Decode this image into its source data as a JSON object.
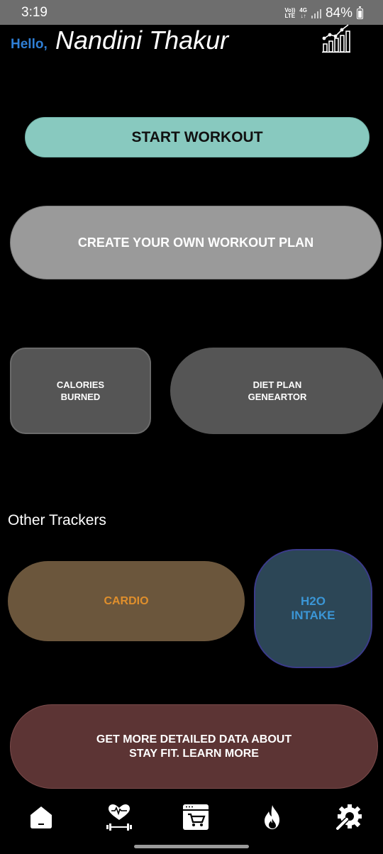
{
  "status_bar": {
    "time": "3:19",
    "volte": "Vo)) LTE",
    "network": "4G",
    "battery": "84%"
  },
  "header": {
    "greeting": "Hello,",
    "user_name": "Nandini Thakur",
    "stats_icon": "bar-chart-trend-icon"
  },
  "actions": {
    "start_workout": "START WORKOUT",
    "create_plan": "CREATE YOUR OWN WORKOUT PLAN",
    "calories": "CALORIES\nBURNED",
    "diet_plan": "DIET PLAN\nGENEARTOR"
  },
  "trackers": {
    "title": "Other Trackers",
    "cardio": "CARDIO",
    "h2o": "H2O\nINTAKE"
  },
  "learn_more": "GET MORE DETAILED DATA ABOUT\nSTAY FIT. LEARN MORE",
  "bottom_nav": {
    "items": [
      "home-icon",
      "fitness-heart-dumbbell-icon",
      "shop-cart-icon",
      "flame-icon",
      "settings-wrench-gear-icon"
    ]
  },
  "colors": {
    "background": "#000000",
    "start_button": "#88c9bf",
    "create_button": "#9a9a9a",
    "card_gray": "#555555",
    "cardio_bg": "#6b563c",
    "cardio_text": "#e08f2c",
    "h2o_bg": "#2c4656",
    "h2o_text": "#3b96d6",
    "learn_bg": "#5c3434",
    "hello_blue": "#2f7fd6"
  }
}
